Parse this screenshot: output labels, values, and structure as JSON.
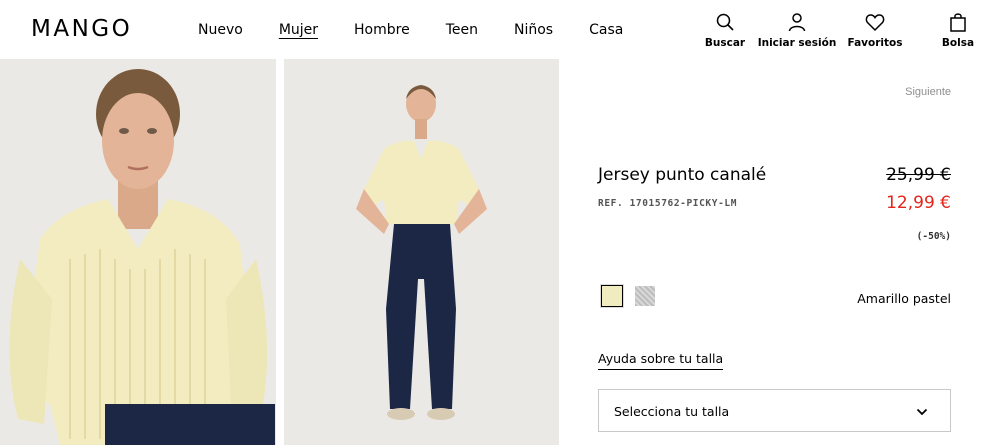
{
  "brand": {
    "logo_text": "MANGO"
  },
  "nav": {
    "items": [
      {
        "label": "Nuevo",
        "active": false
      },
      {
        "label": "Mujer",
        "active": true
      },
      {
        "label": "Hombre",
        "active": false
      },
      {
        "label": "Teen",
        "active": false
      },
      {
        "label": "Niños",
        "active": false
      },
      {
        "label": "Casa",
        "active": false
      }
    ]
  },
  "actions": {
    "search": {
      "label": "Buscar",
      "icon": "search-icon"
    },
    "login": {
      "label": "Iniciar sesión",
      "icon": "user-icon"
    },
    "favorites": {
      "label": "Favoritos",
      "icon": "heart-icon"
    },
    "bag": {
      "label": "Bolsa",
      "icon": "bag-icon"
    }
  },
  "product": {
    "next_label": "Siguiente",
    "title": "Jersey punto canalé",
    "ref": "REF. 17015762-PICKY-LM",
    "old_price": "25,99 €",
    "new_price": "12,99 €",
    "discount": "(-50%)",
    "price_color": "#e4251b",
    "colors": [
      {
        "swatch": "#f1ebc0",
        "selected": true
      },
      {
        "swatch": "#c9c9c9",
        "selected": false
      }
    ],
    "selected_color_name": "Amarillo pastel",
    "size_help_label": "Ayuda sobre tu talla",
    "size_select_label": "Selecciona tu talla"
  }
}
